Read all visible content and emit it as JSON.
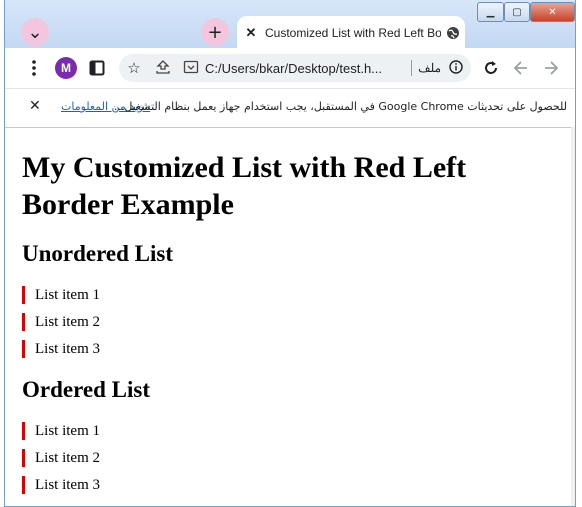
{
  "browser": {
    "tab_title": "Customized List with Red Left Bo",
    "tab_close_glyph": "✕",
    "new_tab_glyph": "+",
    "tab_search_glyph": "⌄",
    "window_controls": {
      "minimize": "▁",
      "maximize": "▢",
      "close": "✕"
    },
    "profile_initial": "M",
    "address_text": "C:/Users/bkar/Desktop/test.h...",
    "file_label": "ملف",
    "infobar_message": "للحصول على تحديثات Google Chrome في المستقبل، يجب استخدام جهاز يعمل بنظام التشغيل...",
    "infobar_link": "مزيد من المعلومات",
    "infobar_close": "✕"
  },
  "page": {
    "heading": "My Customized List with Red Left Border Example",
    "unordered_heading": "Unordered List",
    "unordered_items": [
      "List item 1",
      "List item 2",
      "List item 3"
    ],
    "ordered_heading": "Ordered List",
    "ordered_items": [
      "List item 1",
      "List item 2",
      "List item 3"
    ]
  },
  "colors": {
    "border_accent": "#e00000",
    "link": "#1a5fd0",
    "avatar": "#7a2bb0",
    "tab_button": "#f3c6de"
  }
}
